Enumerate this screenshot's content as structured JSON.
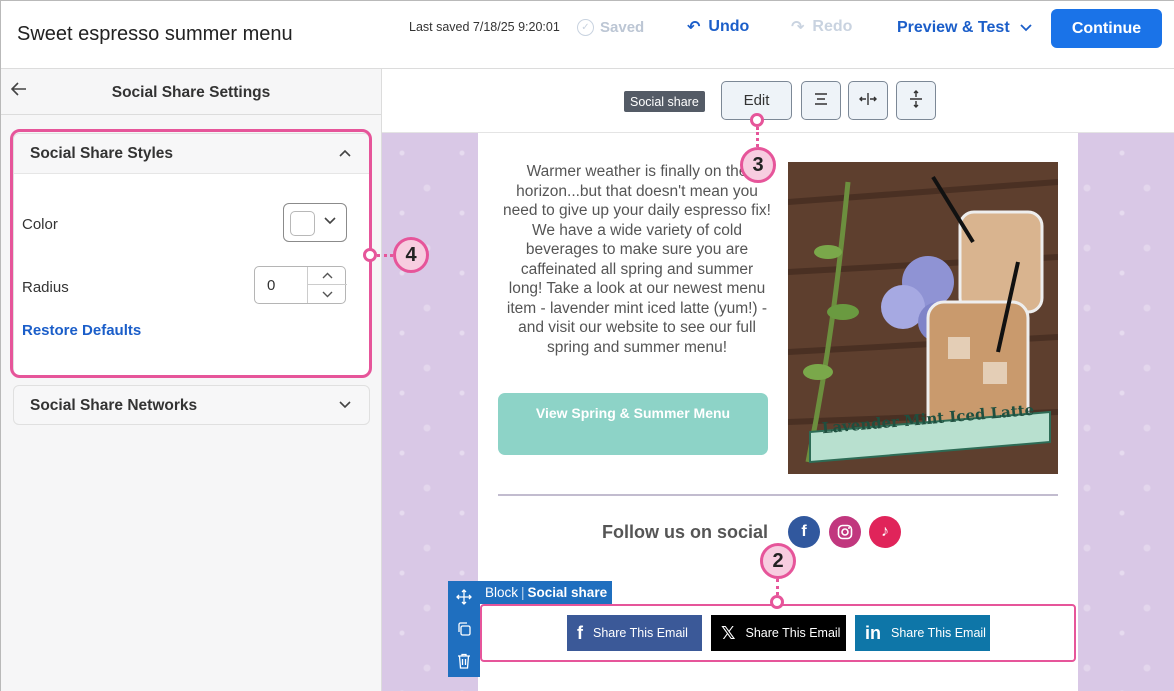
{
  "header": {
    "title": "Sweet espresso summer menu",
    "last_saved": "Last saved 7/18/25 9:20:01",
    "saved_label": "Saved",
    "undo_label": "Undo",
    "redo_label": "Redo",
    "preview_label": "Preview & Test",
    "continue_label": "Continue"
  },
  "panel": {
    "title": "Social Share Settings",
    "styles_section": {
      "title": "Social Share Styles",
      "color_label": "Color",
      "color_value": "#ffffff",
      "radius_label": "Radius",
      "radius_value": "0",
      "restore_label": "Restore Defaults"
    },
    "networks_section": {
      "title": "Social Share Networks"
    }
  },
  "toolbar": {
    "block_label": "Social share",
    "edit_label": "Edit"
  },
  "email": {
    "body_text": "Warmer weather is finally on the horizon...but that doesn't mean you need to give up your daily espresso fix! We have a wide variety of cold beverages to make sure you are caffeinated all spring and summer long! Take a look at our newest menu item - lavender mint iced latte (yum!) - and visit our website to see our full spring and summer menu!",
    "cta_label": "View Spring & Summer Menu",
    "image_caption": "Lavender Mint Iced Latte",
    "follow_label": "Follow us on social",
    "social_icons": [
      "facebook-icon",
      "instagram-icon",
      "tiktok-icon"
    ]
  },
  "block": {
    "prefix": "Block",
    "name": "Social share",
    "share_buttons": [
      {
        "network": "facebook",
        "label": "Share This Email",
        "color": "#3b5998"
      },
      {
        "network": "x",
        "label": "Share This Email",
        "color": "#000000"
      },
      {
        "network": "linkedin",
        "label": "Share This Email",
        "color": "#0e76a8"
      }
    ]
  },
  "callouts": [
    "2",
    "3",
    "4"
  ],
  "colors": {
    "primary": "#1a73e8",
    "link": "#1b5ec9",
    "highlight": "#e6559a",
    "cta": "#8dd3c7",
    "background": "#d9c8e6"
  }
}
